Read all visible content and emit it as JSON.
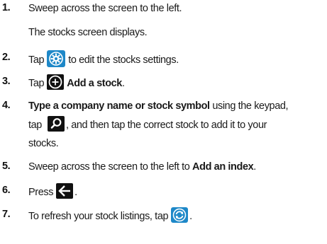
{
  "steps": [
    {
      "num": "1.",
      "text": "Sweep across the screen to the left.",
      "sub": "The stocks screen displays."
    },
    {
      "num": "2.",
      "pre": "Tap",
      "icon": "gear-icon",
      "post": "to edit the stocks settings."
    },
    {
      "num": "3.",
      "pre": "Tap",
      "icon": "add-circle-icon",
      "bold": "Add a stock",
      "post": "."
    },
    {
      "num": "4.",
      "bold": "Type a company name or stock symbol",
      "post1": " using the keypad,",
      "line2_pre": "tap",
      "icon": "search-icon",
      "line2_post": ", and then tap the correct stock to add it to your",
      "line3": "stocks."
    },
    {
      "num": "5.",
      "pre": "Sweep across the screen to the left to ",
      "bold": "Add an index",
      "post": "."
    },
    {
      "num": "6.",
      "pre": "Press",
      "icon": "back-arrow-icon",
      "post": "."
    },
    {
      "num": "7.",
      "pre": "To refresh your stock listings, tap",
      "icon": "refresh-icon",
      "post": "."
    }
  ],
  "colors": {
    "text": "#1a1a1a",
    "icon_bg_blue": "#1e88c8",
    "icon_bg_black": "#111111",
    "icon_fg": "#ffffff"
  }
}
